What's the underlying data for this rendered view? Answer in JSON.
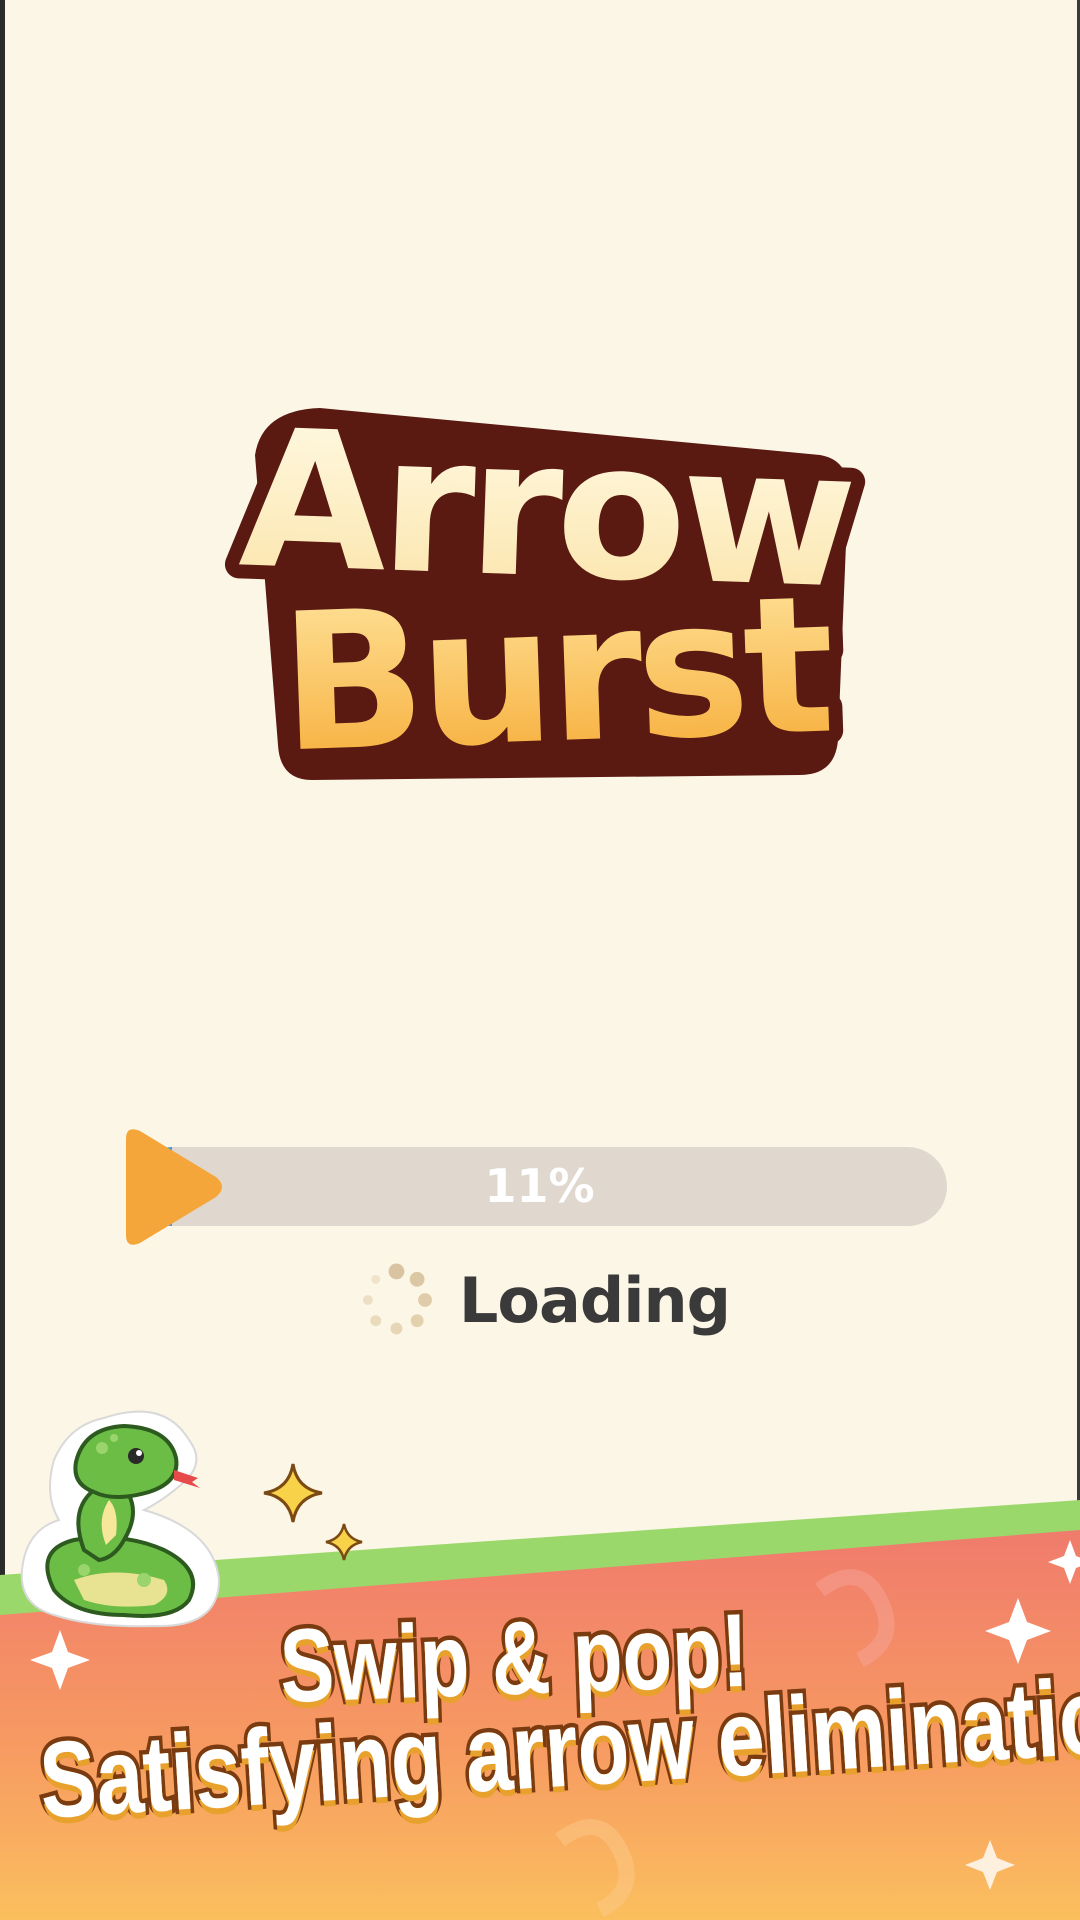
{
  "game": {
    "title_line1": "Arrow",
    "title_line2": "Burst"
  },
  "loading": {
    "progress_label": "11%",
    "progress_value": 0.11,
    "status_text": "Loading"
  },
  "banner": {
    "slogan_line1": "Swip & pop!",
    "slogan_line2": "Satisfying arrow elimination"
  },
  "icons": {
    "progress_thumb": "play-arrow-icon",
    "spinner": "loading-spinner-icon",
    "mascot": "snake-mascot-icon",
    "sparkle": "sparkle-icon"
  },
  "colors": {
    "background": "#fcf6e6",
    "progress_track": "#e0d8cf",
    "progress_fill": "#3a9bec",
    "progress_thumb": "#f4a63a",
    "logo_fill_top": "#fff3cc",
    "logo_fill_bottom": "#fbb43a",
    "logo_outline": "#5a1a12",
    "banner_green": "#9bd86c",
    "banner_red": "#f07b6c",
    "banner_orange": "#fbb45a"
  }
}
